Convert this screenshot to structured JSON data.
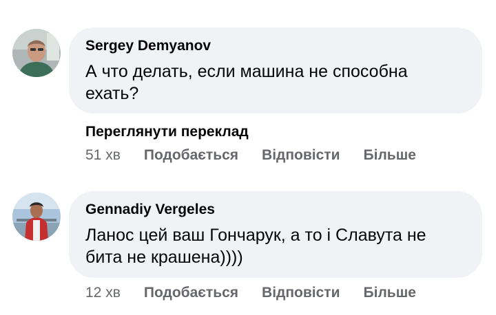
{
  "comments": [
    {
      "author": "Sergey Demyanov",
      "text": "А что делать, если машина не способна ехать?",
      "translate_link": "Переглянути переклад",
      "time": "51 хв",
      "like_label": "Подобається",
      "reply_label": "Відповісти",
      "more_label": "Більше"
    },
    {
      "author": "Gennadiy Vergeles",
      "text": "Ланос цей ваш Гончарук, а то і Славута не бита не крашена))))",
      "time": "12 хв",
      "like_label": "Подобається",
      "reply_label": "Відповісти",
      "more_label": "Більше"
    }
  ],
  "colors": {
    "bubble": "#f0f2f5",
    "secondary_text": "#65676b",
    "primary_text": "#050505"
  }
}
